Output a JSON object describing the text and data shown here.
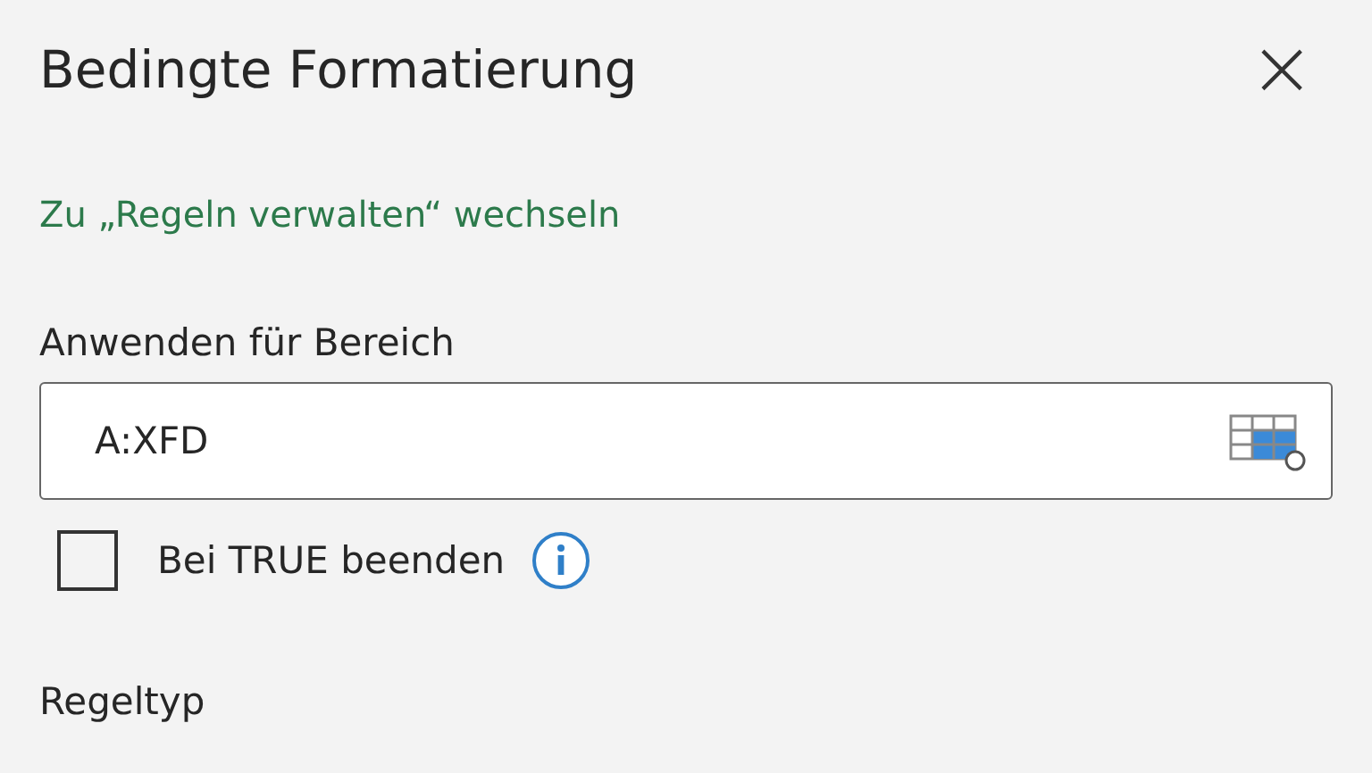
{
  "panel": {
    "title": "Bedingte Formatierung",
    "close": "×"
  },
  "manage_link": "Zu „Regeln verwalten“ wechseln",
  "range": {
    "label": "Anwenden für Bereich",
    "value": "A:XFD"
  },
  "stop_if_true": {
    "label": "Bei TRUE beenden",
    "checked": false
  },
  "rule_type": {
    "label": "Regeltyp"
  }
}
